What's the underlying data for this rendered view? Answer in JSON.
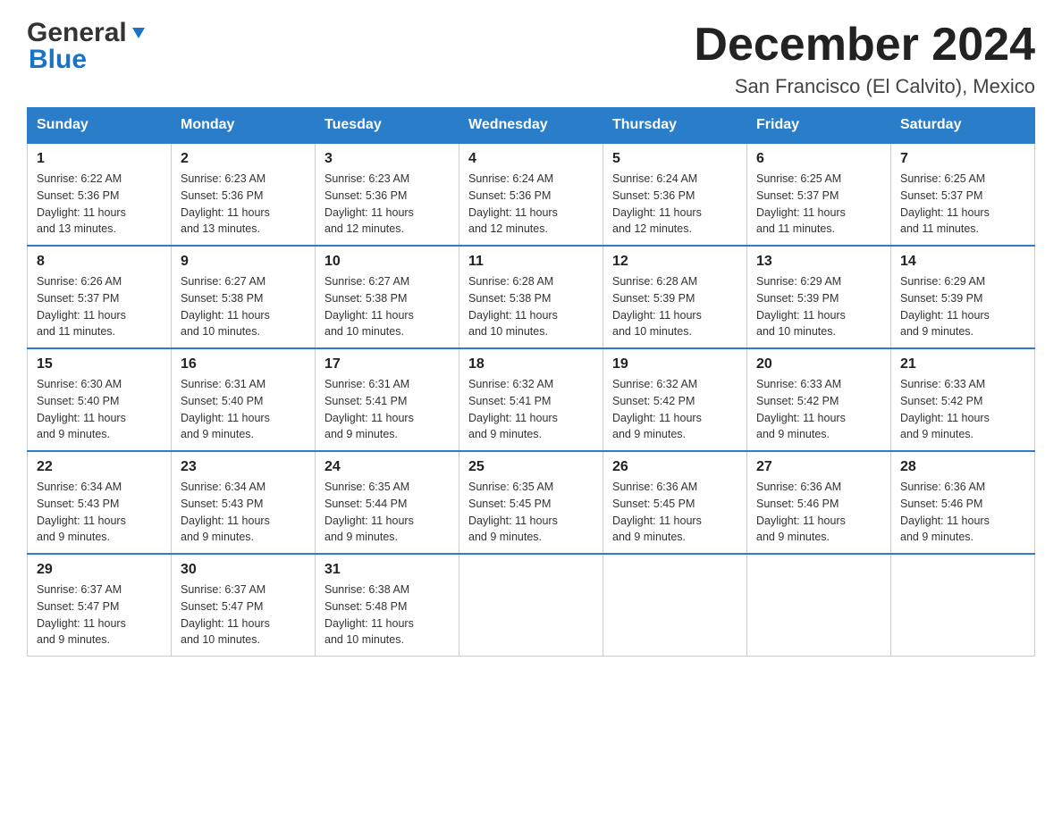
{
  "header": {
    "logo_general": "General",
    "logo_blue": "Blue",
    "month_title": "December 2024",
    "location": "San Francisco (El Calvito), Mexico"
  },
  "days_of_week": [
    "Sunday",
    "Monday",
    "Tuesday",
    "Wednesday",
    "Thursday",
    "Friday",
    "Saturday"
  ],
  "weeks": [
    [
      {
        "day": "1",
        "sunrise": "6:22 AM",
        "sunset": "5:36 PM",
        "daylight": "11 hours and 13 minutes."
      },
      {
        "day": "2",
        "sunrise": "6:23 AM",
        "sunset": "5:36 PM",
        "daylight": "11 hours and 13 minutes."
      },
      {
        "day": "3",
        "sunrise": "6:23 AM",
        "sunset": "5:36 PM",
        "daylight": "11 hours and 12 minutes."
      },
      {
        "day": "4",
        "sunrise": "6:24 AM",
        "sunset": "5:36 PM",
        "daylight": "11 hours and 12 minutes."
      },
      {
        "day": "5",
        "sunrise": "6:24 AM",
        "sunset": "5:36 PM",
        "daylight": "11 hours and 12 minutes."
      },
      {
        "day": "6",
        "sunrise": "6:25 AM",
        "sunset": "5:37 PM",
        "daylight": "11 hours and 11 minutes."
      },
      {
        "day": "7",
        "sunrise": "6:25 AM",
        "sunset": "5:37 PM",
        "daylight": "11 hours and 11 minutes."
      }
    ],
    [
      {
        "day": "8",
        "sunrise": "6:26 AM",
        "sunset": "5:37 PM",
        "daylight": "11 hours and 11 minutes."
      },
      {
        "day": "9",
        "sunrise": "6:27 AM",
        "sunset": "5:38 PM",
        "daylight": "11 hours and 10 minutes."
      },
      {
        "day": "10",
        "sunrise": "6:27 AM",
        "sunset": "5:38 PM",
        "daylight": "11 hours and 10 minutes."
      },
      {
        "day": "11",
        "sunrise": "6:28 AM",
        "sunset": "5:38 PM",
        "daylight": "11 hours and 10 minutes."
      },
      {
        "day": "12",
        "sunrise": "6:28 AM",
        "sunset": "5:39 PM",
        "daylight": "11 hours and 10 minutes."
      },
      {
        "day": "13",
        "sunrise": "6:29 AM",
        "sunset": "5:39 PM",
        "daylight": "11 hours and 10 minutes."
      },
      {
        "day": "14",
        "sunrise": "6:29 AM",
        "sunset": "5:39 PM",
        "daylight": "11 hours and 9 minutes."
      }
    ],
    [
      {
        "day": "15",
        "sunrise": "6:30 AM",
        "sunset": "5:40 PM",
        "daylight": "11 hours and 9 minutes."
      },
      {
        "day": "16",
        "sunrise": "6:31 AM",
        "sunset": "5:40 PM",
        "daylight": "11 hours and 9 minutes."
      },
      {
        "day": "17",
        "sunrise": "6:31 AM",
        "sunset": "5:41 PM",
        "daylight": "11 hours and 9 minutes."
      },
      {
        "day": "18",
        "sunrise": "6:32 AM",
        "sunset": "5:41 PM",
        "daylight": "11 hours and 9 minutes."
      },
      {
        "day": "19",
        "sunrise": "6:32 AM",
        "sunset": "5:42 PM",
        "daylight": "11 hours and 9 minutes."
      },
      {
        "day": "20",
        "sunrise": "6:33 AM",
        "sunset": "5:42 PM",
        "daylight": "11 hours and 9 minutes."
      },
      {
        "day": "21",
        "sunrise": "6:33 AM",
        "sunset": "5:42 PM",
        "daylight": "11 hours and 9 minutes."
      }
    ],
    [
      {
        "day": "22",
        "sunrise": "6:34 AM",
        "sunset": "5:43 PM",
        "daylight": "11 hours and 9 minutes."
      },
      {
        "day": "23",
        "sunrise": "6:34 AM",
        "sunset": "5:43 PM",
        "daylight": "11 hours and 9 minutes."
      },
      {
        "day": "24",
        "sunrise": "6:35 AM",
        "sunset": "5:44 PM",
        "daylight": "11 hours and 9 minutes."
      },
      {
        "day": "25",
        "sunrise": "6:35 AM",
        "sunset": "5:45 PM",
        "daylight": "11 hours and 9 minutes."
      },
      {
        "day": "26",
        "sunrise": "6:36 AM",
        "sunset": "5:45 PM",
        "daylight": "11 hours and 9 minutes."
      },
      {
        "day": "27",
        "sunrise": "6:36 AM",
        "sunset": "5:46 PM",
        "daylight": "11 hours and 9 minutes."
      },
      {
        "day": "28",
        "sunrise": "6:36 AM",
        "sunset": "5:46 PM",
        "daylight": "11 hours and 9 minutes."
      }
    ],
    [
      {
        "day": "29",
        "sunrise": "6:37 AM",
        "sunset": "5:47 PM",
        "daylight": "11 hours and 9 minutes."
      },
      {
        "day": "30",
        "sunrise": "6:37 AM",
        "sunset": "5:47 PM",
        "daylight": "11 hours and 10 minutes."
      },
      {
        "day": "31",
        "sunrise": "6:38 AM",
        "sunset": "5:48 PM",
        "daylight": "11 hours and 10 minutes."
      },
      null,
      null,
      null,
      null
    ]
  ],
  "labels": {
    "sunrise": "Sunrise:",
    "sunset": "Sunset:",
    "daylight": "Daylight:"
  }
}
